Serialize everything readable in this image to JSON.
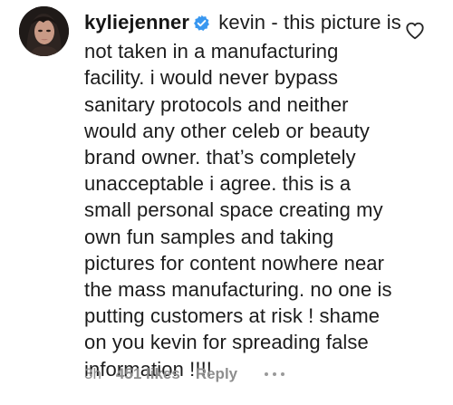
{
  "comment": {
    "username": "kyliejenner",
    "verified": true,
    "text": "kevin - this picture is not taken in a manufacturing facility. i would never bypass sanitary protocols and neither would any other celeb or beauty brand owner. that’s completely unacceptable i agree. this is a small personal space creating my own fun samples and taking pictures for content nowhere near the mass manufacturing. no one is putting customers at risk ! shame on you kevin for spreading false information !!!!",
    "time": "3h",
    "likes": "451 likes",
    "reply_label": "Reply"
  },
  "icons": {
    "verified": "verified-badge-icon",
    "like": "heart-icon",
    "more": "more-options-icon"
  },
  "colors": {
    "verified_blue": "#3897f0",
    "meta_gray": "#8e8e8e",
    "text": "#1c1c1c"
  }
}
